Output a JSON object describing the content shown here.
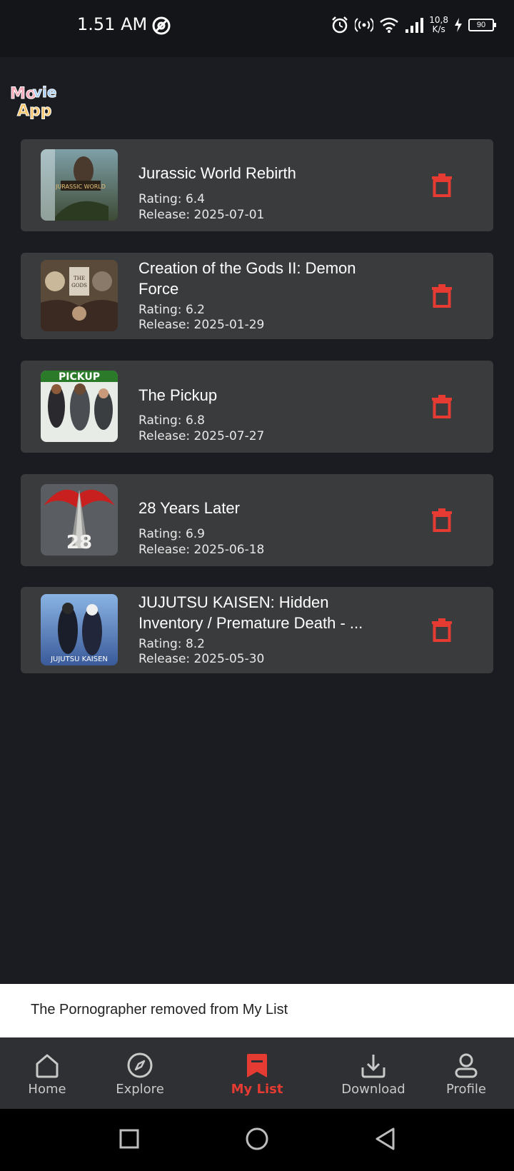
{
  "status": {
    "time": "1.51 AM",
    "net_speed_value": "10,8",
    "net_speed_unit": "K/s",
    "battery": "90"
  },
  "app": {
    "logo_alt": "Movie App"
  },
  "movies": [
    {
      "title": "Jurassic World Rebirth",
      "rating": "Rating: 6.4",
      "release": "Release: 2025-07-01"
    },
    {
      "title": "Creation of the Gods II: Demon Force",
      "rating": "Rating: 6.2",
      "release": "Release: 2025-01-29"
    },
    {
      "title": "The Pickup",
      "rating": "Rating: 6.8",
      "release": "Release: 2025-07-27"
    },
    {
      "title": "28 Years Later",
      "rating": "Rating: 6.9",
      "release": "Release: 2025-06-18"
    },
    {
      "title": "JUJUTSU KAISEN: Hidden Inventory / Premature Death - ...",
      "rating": "Rating: 8.2",
      "release": "Release: 2025-05-30"
    }
  ],
  "snackbar": {
    "message": "The Pornographer removed from My List"
  },
  "nav": {
    "home": "Home",
    "explore": "Explore",
    "mylist": "My List",
    "download": "Download",
    "profile": "Profile",
    "active": "mylist"
  },
  "colors": {
    "accent": "#e53b33",
    "card": "#3a3b3d",
    "background": "#1b1c21"
  }
}
